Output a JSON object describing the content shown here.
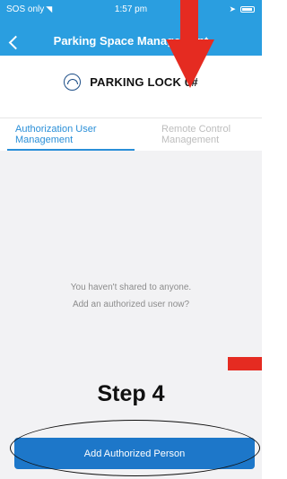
{
  "status_bar": {
    "carrier": "SOS only",
    "time": "1:57 pm",
    "wifi_icon": "wifi-icon",
    "location_icon": "location-arrow-icon",
    "battery_icon": "battery-icon"
  },
  "nav": {
    "title": "Parking Space Management",
    "back_icon": "chevron-left-icon"
  },
  "device": {
    "icon": "parking-lock-icon",
    "name": "PARKING LOCK 0#"
  },
  "tabs": [
    {
      "label": "Authorization User Management",
      "active": true
    },
    {
      "label": "Remote Control Management",
      "active": false
    }
  ],
  "empty_state": {
    "line1": "You haven't shared to anyone.",
    "line2": "Add an authorized user now?"
  },
  "primary_button": {
    "label": "Add Authorized Person"
  },
  "annotation": {
    "step_label": "Step 4",
    "arrow_color": "#e52b21",
    "ellipse": "highlight-ellipse"
  },
  "colors": {
    "header": "#2a9ee0",
    "tab_active": "#2a8fd8",
    "tab_inactive": "#bdbdbd",
    "button": "#1d77c9",
    "content_bg": "#f2f2f4"
  }
}
